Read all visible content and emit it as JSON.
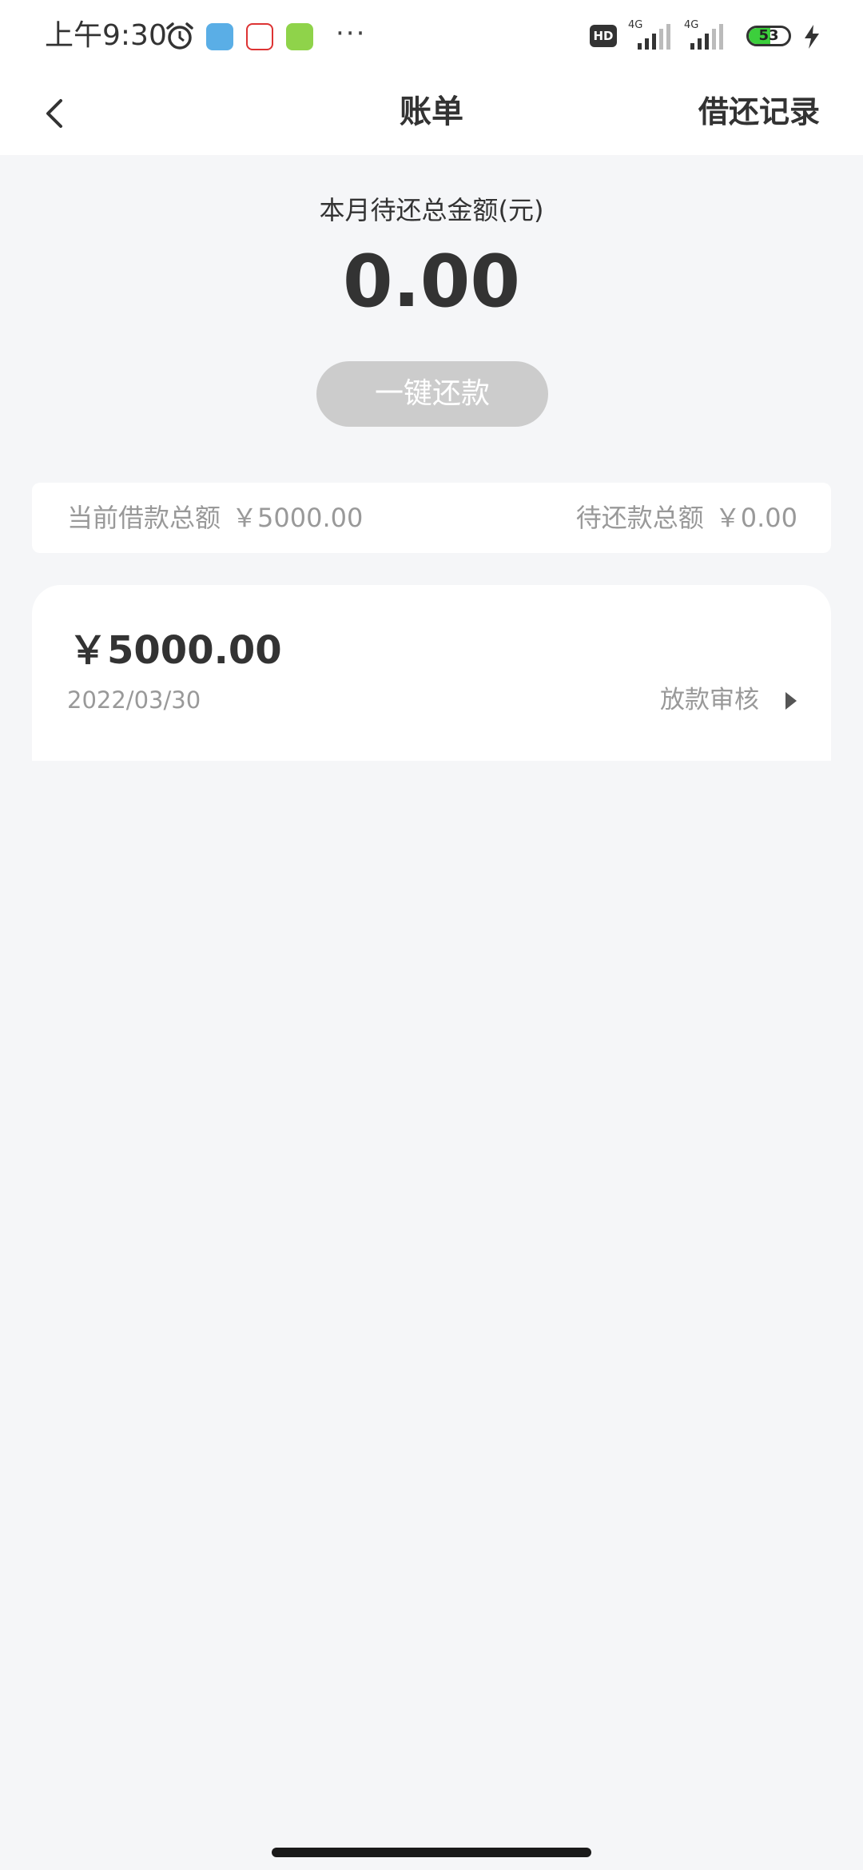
{
  "status_bar": {
    "time": "上午9:30",
    "icons": [
      "alarm-icon",
      "app-icon",
      "app-icon",
      "app-icon",
      "more-icon",
      "hd-icon",
      "signal-icon",
      "signal-icon",
      "battery-icon",
      "charging-icon"
    ],
    "more": "···",
    "hd": "HD",
    "network_1": "4G",
    "network_2": "4G",
    "battery_level": "53",
    "battery_fraction": 0.53,
    "battery_color": "#3ccf3c"
  },
  "nav": {
    "back_icon": "chevron-left-icon",
    "title": "账单",
    "right_action": "借还记录"
  },
  "summary": {
    "label": "本月待还总金额(元)",
    "amount": "0.00",
    "repay_button": "一键还款",
    "repay_button_color": "#cccccc"
  },
  "info": {
    "loan_total_label": "当前借款总额",
    "loan_total_value": "￥5000.00",
    "pending_total_label": "待还款总额",
    "pending_total_value": "￥0.00"
  },
  "bill": {
    "amount": "￥5000.00",
    "date": "2022/03/30",
    "status": "放款审核",
    "arrow_icon": "triangle-right-icon"
  },
  "colors": {
    "background": "#f5f6f8",
    "card": "#ffffff",
    "text_primary": "#333333",
    "text_secondary": "#999999"
  }
}
